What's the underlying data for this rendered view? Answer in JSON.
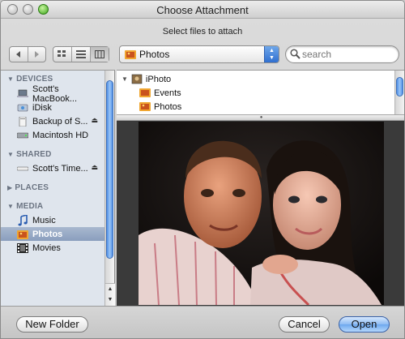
{
  "window": {
    "title": "Choose Attachment",
    "subtitle": "Select files to attach"
  },
  "toolbar": {
    "back_icon": "back-arrow-icon",
    "forward_icon": "forward-arrow-icon",
    "view_modes": [
      "icon-view-icon",
      "list-view-icon",
      "column-view-icon"
    ],
    "active_view": "column-view-icon",
    "location": "Photos",
    "search_placeholder": "search"
  },
  "sidebar": {
    "sections": [
      {
        "header": "DEVICES",
        "items": [
          {
            "label": "Scott's MacBook...",
            "icon": "laptop-icon",
            "eject": false
          },
          {
            "label": "iDisk",
            "icon": "idisk-icon",
            "eject": false
          },
          {
            "label": "Backup of S...",
            "icon": "drive-icon",
            "eject": true
          },
          {
            "label": "Macintosh HD",
            "icon": "hard-drive-icon",
            "eject": false
          }
        ]
      },
      {
        "header": "SHARED",
        "items": [
          {
            "label": "Scott's Time...",
            "icon": "time-capsule-icon",
            "eject": true
          }
        ]
      },
      {
        "header": "PLACES",
        "items": []
      },
      {
        "header": "MEDIA",
        "items": [
          {
            "label": "Music",
            "icon": "music-note-icon",
            "eject": false
          },
          {
            "label": "Photos",
            "icon": "photos-icon",
            "eject": false,
            "selected": true
          },
          {
            "label": "Movies",
            "icon": "film-icon",
            "eject": false
          }
        ]
      }
    ]
  },
  "browser": {
    "root": "iPhoto",
    "children": [
      "Events",
      "Photos"
    ]
  },
  "buttons": {
    "new_folder": "New Folder",
    "cancel": "Cancel",
    "open": "Open"
  },
  "colors": {
    "sidebar_bg": "#dfe5ed",
    "selection": "#8a9ebd",
    "default_button": "#6ea8ee"
  }
}
